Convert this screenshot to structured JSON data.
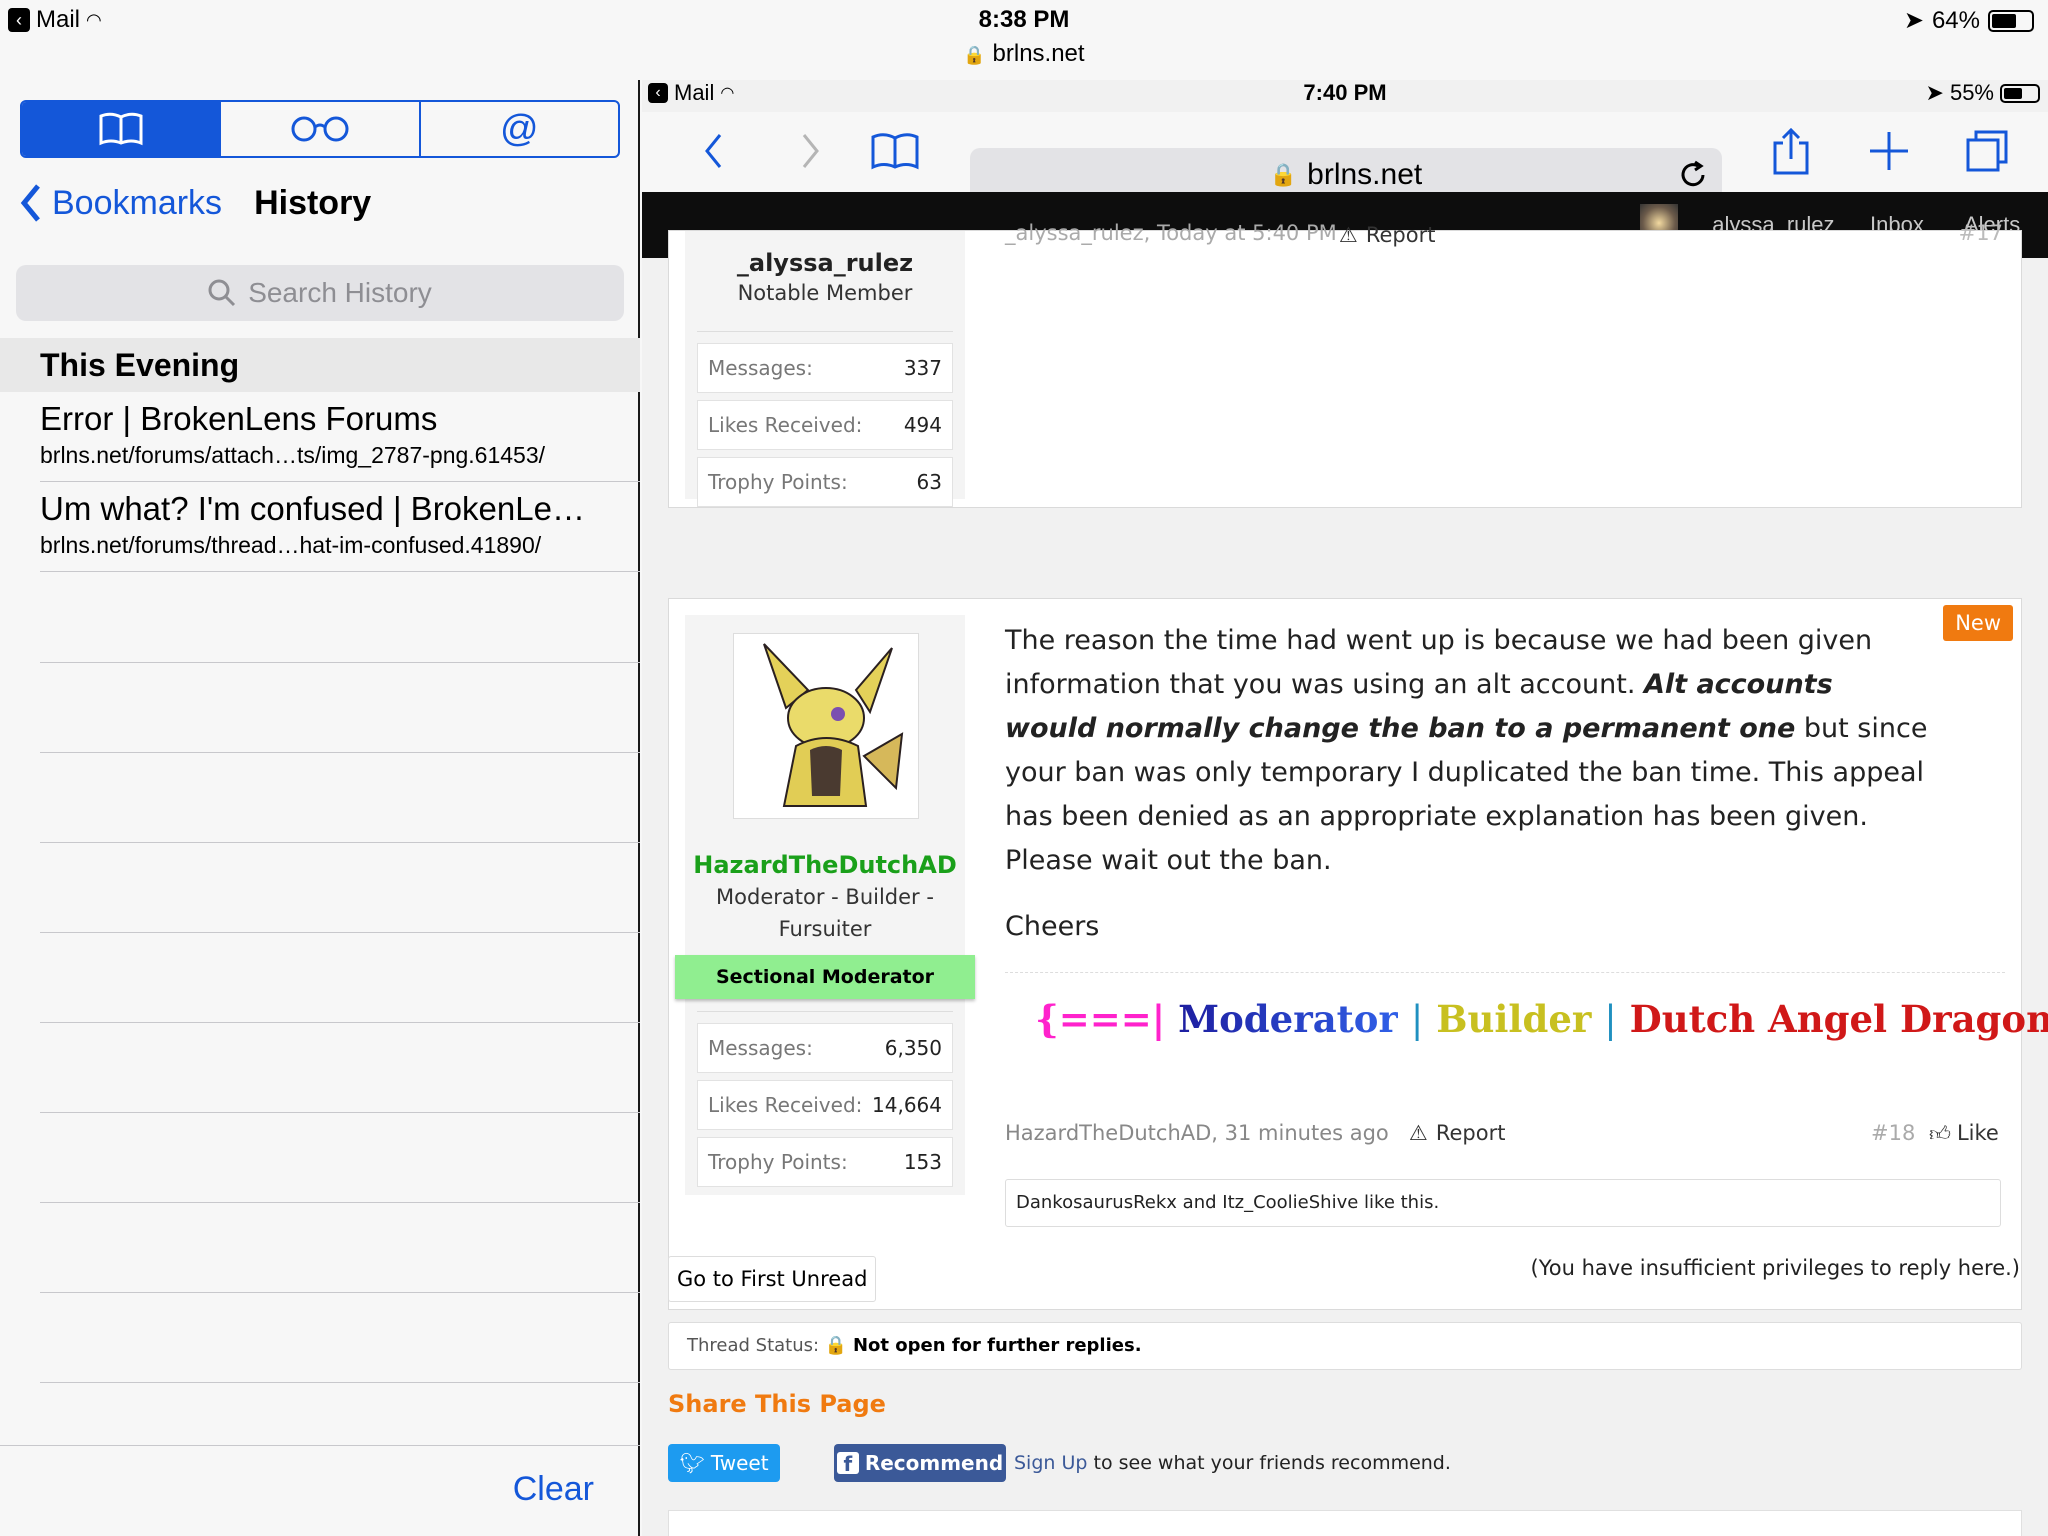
{
  "status": {
    "carrier": "Mail",
    "time": "8:38 PM",
    "url": "brlns.net",
    "battery": "64%",
    "battery_level": 0.64
  },
  "sidebar": {
    "tabs": [
      {
        "name": "bookmarks-tab",
        "icon": "book-icon"
      },
      {
        "name": "reading-list-tab",
        "icon": "glasses-icon"
      },
      {
        "name": "shared-links-tab",
        "icon": "at-icon",
        "label": "@"
      }
    ],
    "back_label": "Bookmarks",
    "title": "History",
    "search_placeholder": "Search History",
    "section": "This Evening",
    "items": [
      {
        "title": "Error | BrokenLens Forums",
        "url": "brlns.net/forums/attach…ts/img_2787-png.61453/"
      },
      {
        "title": "Um what? I'm confused | BrokenLe…",
        "url": "brlns.net/forums/thread…hat-im-confused.41890/"
      }
    ],
    "clear": "Clear"
  },
  "inner": {
    "status": {
      "carrier": "Mail",
      "time": "7:40 PM",
      "battery": "55%",
      "battery_level": 0.55
    },
    "url": "brlns.net",
    "nav": {
      "user": "_alyssa_rulez",
      "inbox": "Inbox",
      "alerts": "Alerts"
    },
    "post17": {
      "meta": "_alyssa_rulez, Today at 5:40 PM",
      "report": "Report",
      "num": "#17",
      "username": "_alyssa_rulez",
      "usertitle": "Notable Member",
      "stats": [
        {
          "k": "Messages:",
          "v": "337"
        },
        {
          "k": "Likes Received:",
          "v": "494"
        },
        {
          "k": "Trophy Points:",
          "v": "63"
        }
      ]
    },
    "post18": {
      "badge": "New",
      "username": "HazardTheDutchAD",
      "usertitle1": "Moderator - Builder -",
      "usertitle2": "Fursuiter",
      "role": "Sectional Moderator",
      "stats": [
        {
          "k": "Messages:",
          "v": "6,350"
        },
        {
          "k": "Likes Received:",
          "v": "14,664"
        },
        {
          "k": "Trophy Points:",
          "v": "153"
        }
      ],
      "text1": "The reason the time had went up is because we had been given",
      "text2a": "information that you was using an alt account. ",
      "text2b": "Alt accounts",
      "text3a": "would normally change the ban to a permanent one",
      "text3b": " but since",
      "text4": "your ban was only temporary I duplicated the ban time. This appeal",
      "text5": "has been denied as an appropriate explanation has been given.",
      "text6": "Please wait out the ban.",
      "cheers": "Cheers",
      "sig": {
        "open": "{===|",
        "mod": "Moderator",
        "bar1": "|",
        "builder": "Builder",
        "bar2": "|",
        "dad": "Dutch Angel Dragon",
        "close": "|===}"
      },
      "meta": "HazardTheDutchAD, 31 minutes ago",
      "report": "Report",
      "num": "#18",
      "like": "Like",
      "likes_a": "DankosaurusRekx",
      "likes_and": " and ",
      "likes_b": "Itz_CoolieShive",
      "likes_end": " like this."
    },
    "first_unread": "Go to First Unread",
    "insufficient": "(You have insufficient privileges to reply here.)",
    "thread_status_label": "Thread Status:",
    "thread_status": "Not open for further replies.",
    "share_title": "Share This Page",
    "tweet": "Tweet",
    "recommend": "Recommend",
    "signup": "Sign Up",
    "signup_rest": " to see what your friends recommend."
  }
}
